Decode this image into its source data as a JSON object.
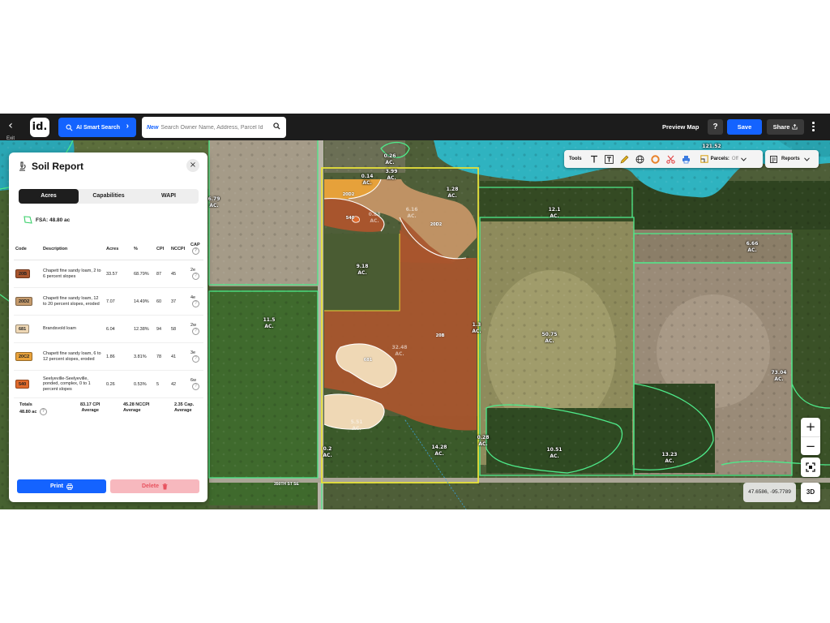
{
  "topbar": {
    "exit_label": "Exit",
    "logo_text": "id.",
    "ai_search_label": "AI Smart Search",
    "search": {
      "badge": "New",
      "placeholder": "Search Owner Name, Address, Parcel Id"
    },
    "preview_map_label": "Preview Map",
    "help_label": "?",
    "save_label": "Save",
    "share_label": "Share"
  },
  "toolbar": {
    "tools_label": "Tools",
    "parcels_label": "Parcels:",
    "parcels_state": "Off",
    "reports_label": "Reports"
  },
  "map": {
    "acreage_labels": [
      "0.26\nAC.",
      "0.14\nAC.",
      "3.99\nAC.",
      "1.28\nAC.",
      "121.52",
      "6.79\nAC.",
      "12.1\nAC.",
      "6.66\nAC.",
      "9.18\nAC.",
      "11.5\nAC.",
      "50.75\nAC.",
      "73.04\nAC.",
      "14.28\nAC.",
      "10.51\nAC.",
      "13.23\nAC.",
      "0.2\nAC.",
      "0.28\nAC.",
      "1.3\nAC."
    ],
    "soil_codes": [
      "20D2",
      "20D2",
      "20B",
      "681",
      "540"
    ],
    "soil_acreage": [
      "0.88\nAC.",
      "6.16\nAC.",
      "32.48\nAC.",
      "5.51\nAC."
    ],
    "road_label": "350TH ST SE",
    "coords": "47.6586, -95.7789",
    "zoom_in": "+",
    "zoom_out": "−",
    "view_3d": "3D"
  },
  "panel": {
    "title": "Soil Report",
    "tabs": [
      "Acres",
      "Capabilities",
      "WAPI"
    ],
    "active_tab": "Acres",
    "fsa_label": "FSA: 48.80 ac",
    "columns": {
      "code": "Code",
      "description": "Description",
      "acres": "Acres",
      "pct": "%",
      "cpi": "CPI",
      "nccpi": "NCCPI",
      "cap": "CAP"
    },
    "rows": [
      {
        "code": "20B",
        "color": "#a8552d",
        "description": "Chapett fine sandy loam, 2 to 6 percent slopes",
        "acres": "33.57",
        "pct": "68.79%",
        "cpi": "87",
        "nccpi": "45",
        "cap": "2e"
      },
      {
        "code": "20D2",
        "color": "#c49a6c",
        "description": "Chapett fine sandy loam, 12 to 20 percent slopes, eroded",
        "acres": "7.07",
        "pct": "14.49%",
        "cpi": "60",
        "nccpi": "37",
        "cap": "4e"
      },
      {
        "code": "681",
        "color": "#efd8b5",
        "description": "Brandsvold loam",
        "acres": "6.04",
        "pct": "12.38%",
        "cpi": "94",
        "nccpi": "58",
        "cap": "2w"
      },
      {
        "code": "20C2",
        "color": "#e9a23b",
        "description": "Chapett fine sandy loam, 6 to 12 percent slopes, eroded",
        "acres": "1.86",
        "pct": "3.81%",
        "cpi": "78",
        "nccpi": "41",
        "cap": "3e"
      },
      {
        "code": "540",
        "color": "#e06a2c",
        "description": "Seelyeville-Seelyeville, ponded, complex, 0 to 1 percent slopes",
        "acres": "0.26",
        "pct": "0.53%",
        "cpi": "5",
        "nccpi": "42",
        "cap": "6w"
      }
    ],
    "totals": {
      "label": "Totals",
      "acres": "48.80 ac",
      "cpi": "83.17 CPI",
      "cpi_sub": "Average",
      "nccpi": "45.28 NCCPI",
      "nccpi_sub": "Average",
      "cap": "2.35 Cap.",
      "cap_sub": "Average"
    },
    "print_label": "Print",
    "delete_label": "Delete"
  }
}
